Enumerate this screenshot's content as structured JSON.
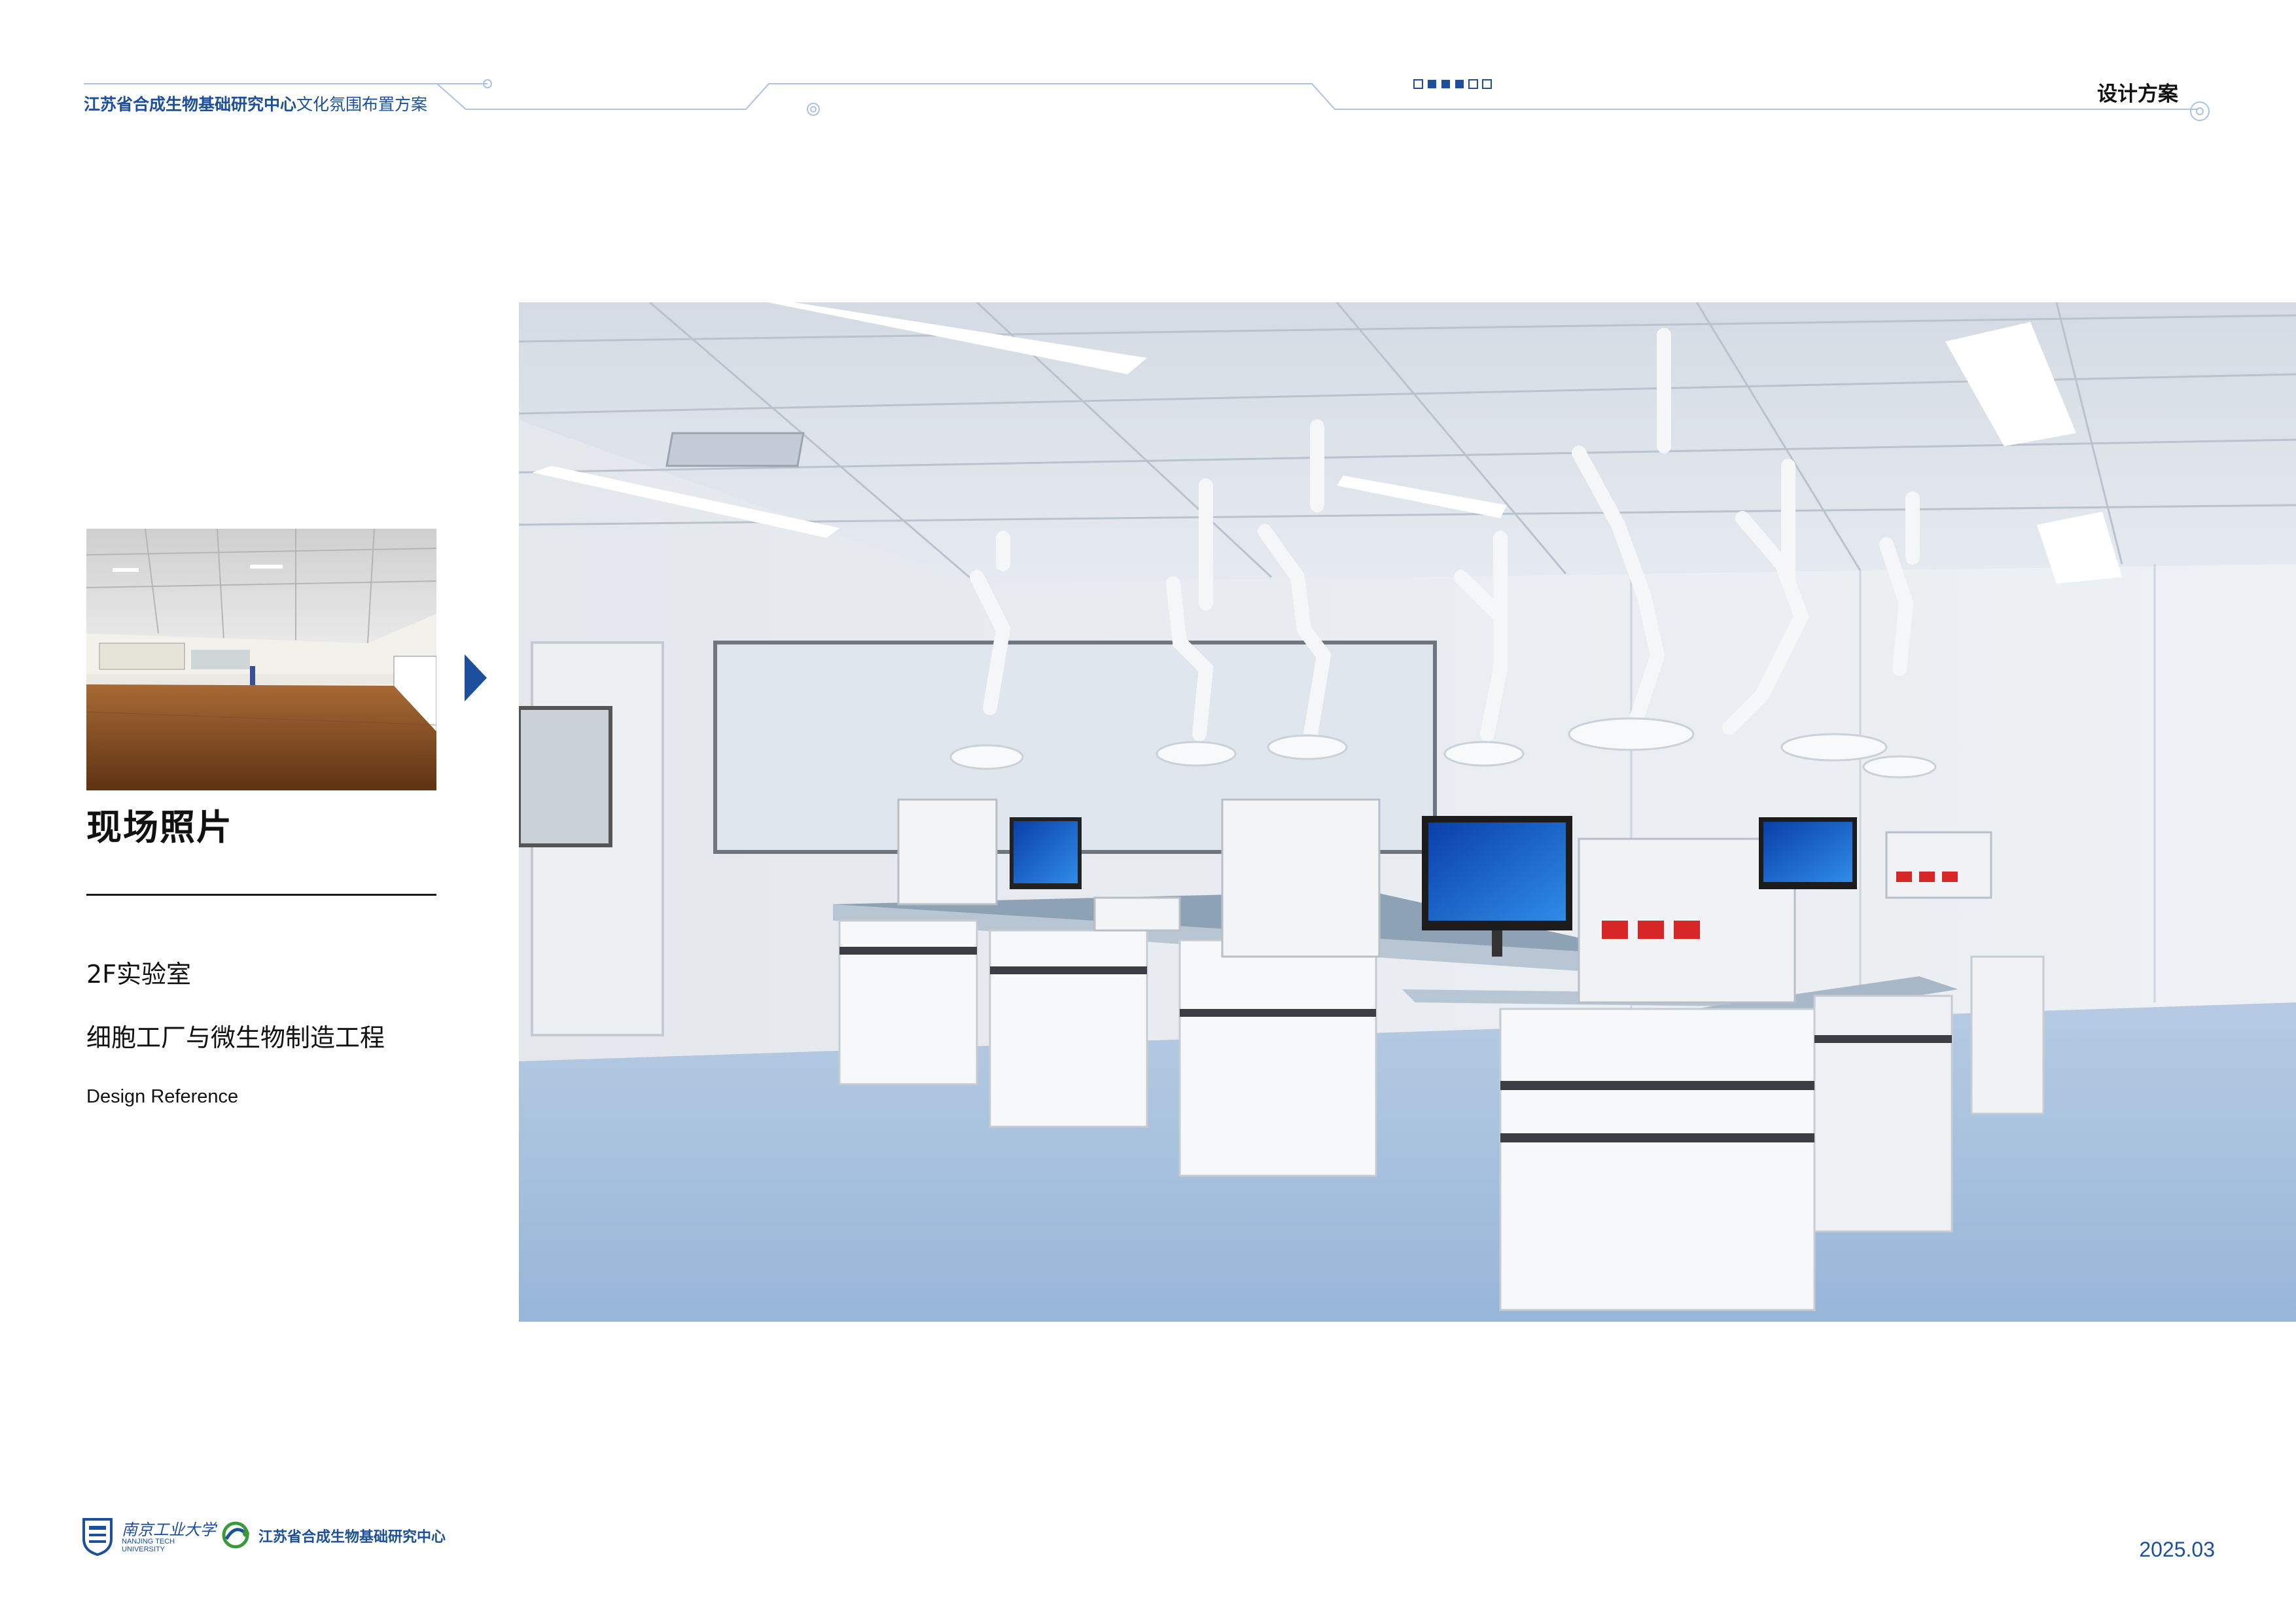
{
  "header": {
    "center_name": "江苏省合成生物基础研究中心",
    "doc_title": "文化氛围布置方案",
    "section": "设计方案",
    "page_indicator": {
      "total": 6,
      "filled": [
        2,
        3,
        4
      ]
    }
  },
  "left_panel": {
    "photo_caption": "现场照片",
    "floor": "2F实验室",
    "project": "细胞工厂与微生物制造工程",
    "english": "Design Reference"
  },
  "footer": {
    "university_cn": "南京工业大学",
    "university_en_line1": "NANJING TECH",
    "university_en_line2": "UNIVERSITY",
    "center_name": "江苏省合成生物基础研究中心",
    "date": "2025.03"
  },
  "colors": {
    "brand_blue": "#1c4f9c",
    "line_blue": "#a9c3e4",
    "floor_blue": "#a3bfdc"
  },
  "icons": {
    "arrow": "triangle-right-icon",
    "university_logo": "university-logo-icon",
    "center_logo": "center-logo-icon"
  }
}
